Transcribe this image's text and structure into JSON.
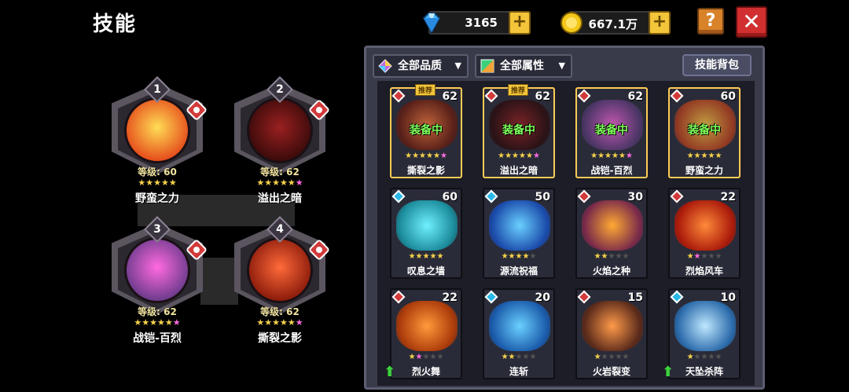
{
  "header": {
    "title": "技能"
  },
  "currency": {
    "gems": "3165",
    "coins": "667.1万",
    "plus_symbol": "+"
  },
  "buttons": {
    "help": "?",
    "close": "✕"
  },
  "equipped": [
    {
      "num": "1",
      "level": "等级: 60",
      "name": "野蛮之力",
      "stars": [
        "g",
        "g",
        "g",
        "g",
        "g"
      ],
      "colors": [
        "#ffdd55",
        "#e54a1a"
      ]
    },
    {
      "num": "2",
      "level": "等级: 62",
      "name": "溢出之暗",
      "stars": [
        "g",
        "g",
        "g",
        "g",
        "g",
        "p"
      ],
      "colors": [
        "#9a2020",
        "#3a0a0a"
      ]
    },
    {
      "num": "3",
      "level": "等级: 62",
      "name": "战铠-百烈",
      "stars": [
        "g",
        "g",
        "g",
        "g",
        "g",
        "p"
      ],
      "colors": [
        "#ff6ae0",
        "#6a3a8a"
      ]
    },
    {
      "num": "4",
      "level": "等级: 62",
      "name": "撕裂之影",
      "stars": [
        "g",
        "g",
        "g",
        "g",
        "g",
        "p"
      ],
      "colors": [
        "#ff6a3a",
        "#8a1a0a"
      ]
    }
  ],
  "panel": {
    "filter_quality": "全部品质",
    "filter_attr": "全部属性",
    "bag_label": "技能背包",
    "equipped_label": "装备中",
    "recommend_label": "推荐"
  },
  "skills": [
    {
      "name": "撕裂之影",
      "level": "62",
      "equipped": true,
      "recommended": true,
      "stars": [
        "g",
        "g",
        "g",
        "g",
        "g",
        "p"
      ],
      "elem": "#d23a3a",
      "colors": [
        "#ff7a3a",
        "#6a1a0a"
      ]
    },
    {
      "name": "溢出之暗",
      "level": "62",
      "equipped": true,
      "recommended": true,
      "stars": [
        "g",
        "g",
        "g",
        "g",
        "g",
        "p"
      ],
      "elem": "#d23a3a",
      "colors": [
        "#9a2020",
        "#2a0808"
      ]
    },
    {
      "name": "战铠-百烈",
      "level": "62",
      "equipped": true,
      "recommended": false,
      "stars": [
        "g",
        "g",
        "g",
        "g",
        "g",
        "p"
      ],
      "elem": "#d23a3a",
      "colors": [
        "#ff6ae0",
        "#5a3a7a"
      ]
    },
    {
      "name": "野蛮之力",
      "level": "60",
      "equipped": true,
      "recommended": false,
      "stars": [
        "g",
        "g",
        "g",
        "g",
        "g"
      ],
      "elem": "#d23a3a",
      "colors": [
        "#ffcc44",
        "#c0401a"
      ]
    },
    {
      "name": "叹息之墙",
      "level": "60",
      "equipped": false,
      "recommended": false,
      "stars": [
        "g",
        "g",
        "g",
        "g",
        "g"
      ],
      "elem": "#2ab8e8",
      "colors": [
        "#6ff0ff",
        "#1a8a9a"
      ]
    },
    {
      "name": "源流祝福",
      "level": "50",
      "equipped": false,
      "recommended": false,
      "stars": [
        "g",
        "g",
        "g",
        "g",
        "x"
      ],
      "elem": "#2ab8e8",
      "colors": [
        "#6ad0ff",
        "#1a4aaa"
      ]
    },
    {
      "name": "火焰之种",
      "level": "30",
      "equipped": false,
      "recommended": false,
      "stars": [
        "g",
        "g",
        "x",
        "x",
        "x"
      ],
      "elem": "#d23a3a",
      "colors": [
        "#ffaa33",
        "#7a2a4a"
      ]
    },
    {
      "name": "烈焰风车",
      "level": "22",
      "equipped": false,
      "recommended": false,
      "stars": [
        "g",
        "p",
        "x",
        "x",
        "x"
      ],
      "elem": "#d23a3a",
      "colors": [
        "#ff8a3a",
        "#aa1a0a"
      ]
    },
    {
      "name": "烈火舞",
      "level": "22",
      "equipped": false,
      "recommended": false,
      "upgrade": true,
      "stars": [
        "g",
        "p",
        "x",
        "x",
        "x"
      ],
      "elem": "#d23a3a",
      "colors": [
        "#ff9a3a",
        "#aa3a0a"
      ]
    },
    {
      "name": "连斩",
      "level": "20",
      "equipped": false,
      "recommended": false,
      "stars": [
        "g",
        "g",
        "x",
        "x",
        "x"
      ],
      "elem": "#2ab8e8",
      "colors": [
        "#6ad0ff",
        "#1a5aaa"
      ]
    },
    {
      "name": "火岩裂变",
      "level": "15",
      "equipped": false,
      "recommended": false,
      "stars": [
        "g",
        "x",
        "x",
        "x",
        "x"
      ],
      "elem": "#d23a3a",
      "colors": [
        "#ff9a4a",
        "#5a2a1a"
      ]
    },
    {
      "name": "天坠杀阵",
      "level": "10",
      "equipped": false,
      "recommended": false,
      "upgrade": true,
      "stars": [
        "g",
        "x",
        "x",
        "x",
        "x"
      ],
      "elem": "#2ab8e8",
      "colors": [
        "#bfe8ff",
        "#2a6aaa"
      ]
    }
  ],
  "icons": {
    "upgrade": "up-arrow-icon",
    "star": "★"
  }
}
